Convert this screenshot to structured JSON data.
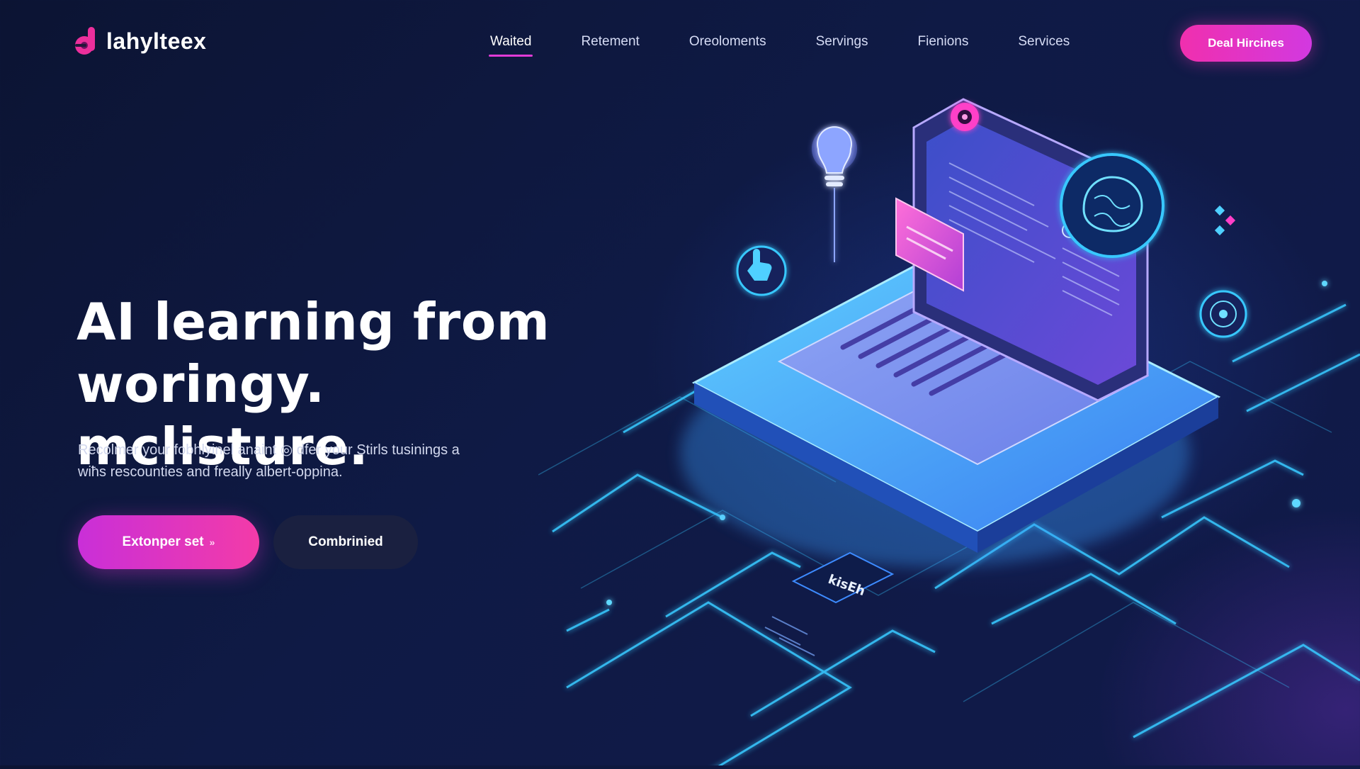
{
  "brand": {
    "name": "lahylteex",
    "color": "#ec2f9c"
  },
  "nav": {
    "links": [
      {
        "label": "Waited",
        "active": true
      },
      {
        "label": "Retement",
        "active": false
      },
      {
        "label": "Oreoloments",
        "active": false
      },
      {
        "label": "Servings",
        "active": false
      },
      {
        "label": "Fienions",
        "active": false
      },
      {
        "label": "Services",
        "active": false
      }
    ],
    "cta_label": "Deal Hircines"
  },
  "hero": {
    "title_line1": "AI learning from",
    "title_line2": "woringy. mclisture.",
    "subtitle_line1": "Recolmer your fobhlyinel anaint ◎ dfer your Stirls tusinings a",
    "subtitle_line2": "wiħs rescounties and freally albert-oppina.",
    "primary_button": "Extonper set",
    "primary_button_icon": "chevron-right-icon",
    "secondary_button": "Combrinied"
  },
  "illustration": {
    "chip_label": "kisEh",
    "icons": [
      "lightbulb-icon",
      "pointer-hand-icon",
      "brain-icon",
      "target-icon",
      "circuit-dial-icon"
    ]
  },
  "colors": {
    "accent_pink": "#f02fae",
    "accent_magenta": "#d239e0",
    "neon_cyan": "#36c6ff",
    "background": "#0f1a45"
  }
}
